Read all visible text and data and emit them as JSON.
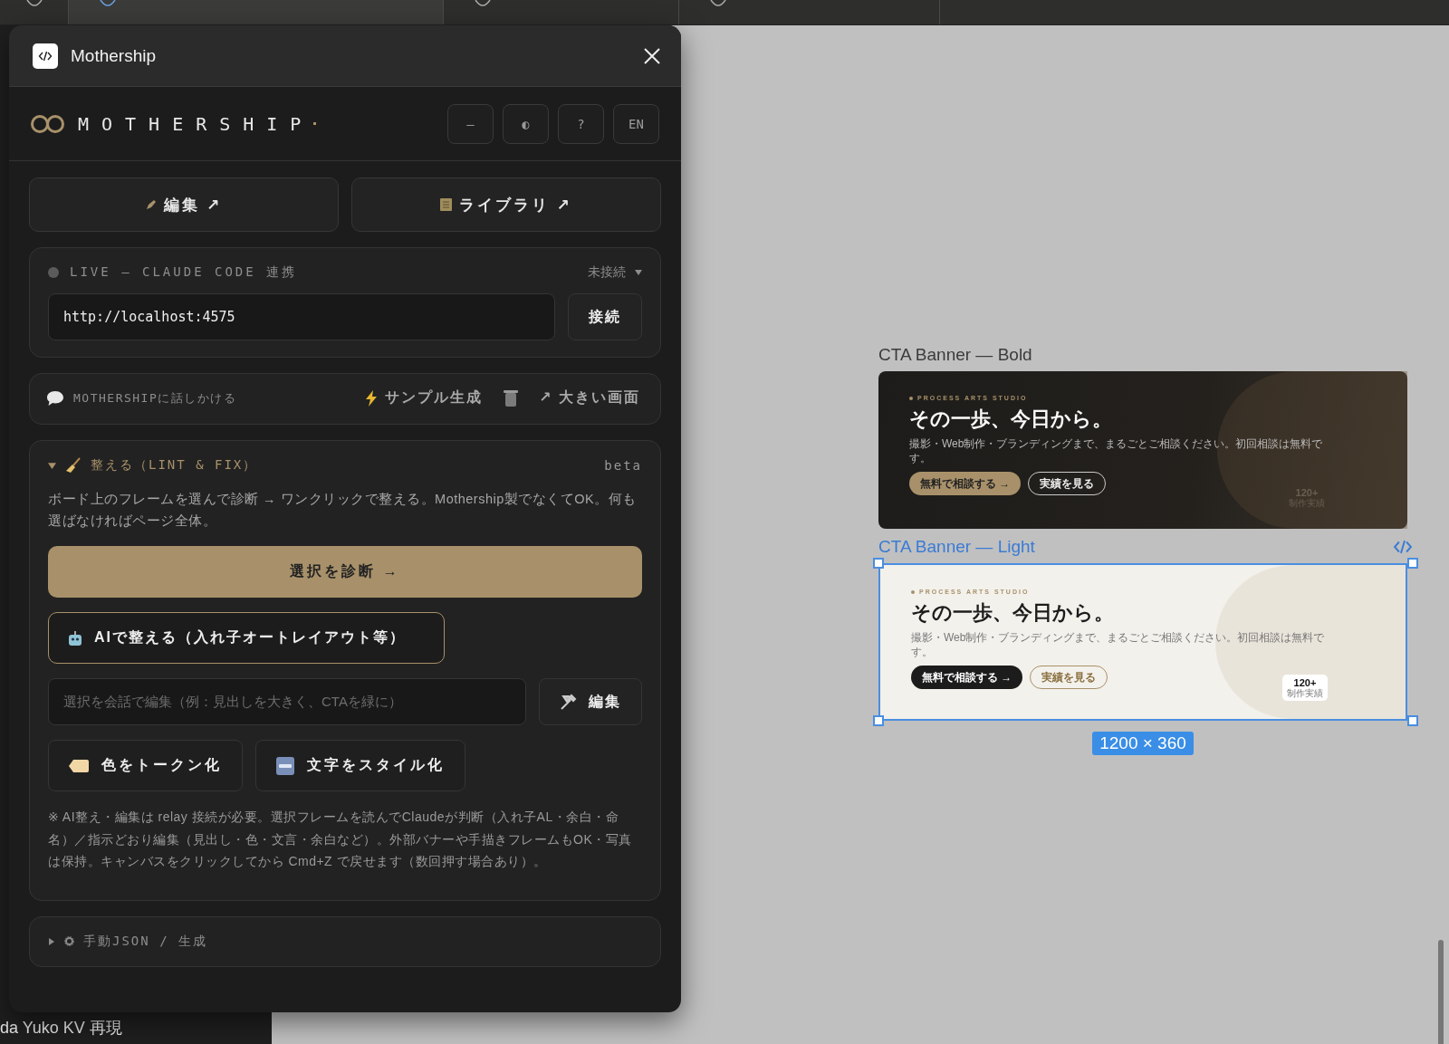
{
  "tabs": [
    {
      "selected": false
    },
    {
      "selected": true
    },
    {
      "selected": false
    },
    {
      "selected": false
    }
  ],
  "sidebar": {
    "footer_item": "da Yuko KV 再現"
  },
  "panel": {
    "title": "Mothership",
    "brand": "MOTHERSHIP",
    "header_buttons": [
      "—",
      "◐",
      "?",
      "EN"
    ],
    "links": [
      {
        "kind": "edit",
        "label": "編集 ↗"
      },
      {
        "kind": "library",
        "label": "ライブラリ ↗"
      }
    ],
    "live": {
      "connected": false,
      "title": "LIVE — CLAUDE CODE 連携",
      "status": "未接続",
      "url": "http://localhost:4575",
      "button": "接続"
    },
    "chat": {
      "label": "MOTHERSHIPに話しかける",
      "actions": [
        {
          "kind": "bolt",
          "label": "サンプル生成"
        },
        {
          "kind": "trash"
        },
        {
          "kind": "text",
          "label": "↗ 大きい画面"
        }
      ]
    },
    "lint": {
      "expanded": true,
      "title": "整える（LINT & FIX）",
      "badge": "beta",
      "description": "ボード上のフレームを選んで診断 → ワンクリックで整える。Mothership製でなくてOK。何も選ばなければページ全体。",
      "primary": "選択を診断 →",
      "ai_button": "AIで整える（入れ子オートレイアウト等）",
      "edit_placeholder": "選択を会話で編集（例：見出しを大きく、CTAを緑に）",
      "edit_button": "編集",
      "tools": [
        {
          "kind": "tag",
          "label": "色をトークン化"
        },
        {
          "kind": "abc",
          "label": "文字をスタイル化"
        }
      ],
      "note": "※ AI整え・編集は relay 接続が必要。選択フレームを読んでClaudeが判断（入れ子AL・余白・命名）／指示どおり編集（見出し・色・文言・余白など）。外部バナーや手描きフレームもOK・写真は保持。キャンバスをクリックしてから Cmd+Z で戻せます（数回押す場合あり）。"
    },
    "manual": {
      "expanded": false,
      "title": "手動JSON / 生成"
    }
  },
  "canvas": {
    "frames": [
      {
        "label": "CTA Banner — Bold",
        "selected": false,
        "dark": true,
        "eyebrow": "PROCESS ARTS STUDIO",
        "heading": "その一歩、今日から。",
        "body": "撮影・Web制作・ブランディングまで、まるごとご相談ください。初回相談は無料です。",
        "primary": "無料で相談する →",
        "secondary": "実績を見る",
        "stat": "120+",
        "stat_label": "制作実績"
      },
      {
        "label": "CTA Banner — Light",
        "selected": true,
        "dark": false,
        "eyebrow": "PROCESS ARTS STUDIO",
        "heading": "その一歩、今日から。",
        "body": "撮影・Web制作・ブランディングまで、まるごとご相談ください。初回相談は無料です。",
        "primary": "無料で相談する →",
        "secondary": "実績を見る",
        "stat": "120+",
        "stat_label": "制作実績",
        "size": "1200 × 360"
      }
    ]
  }
}
